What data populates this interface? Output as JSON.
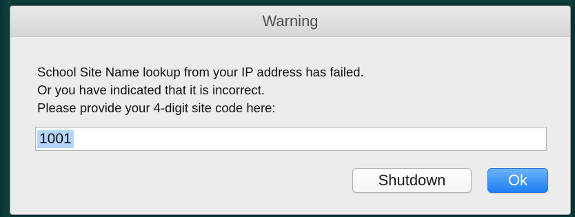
{
  "dialog": {
    "title": "Warning",
    "message_lines": [
      "School Site Name lookup from your IP address has failed.",
      "Or you have indicated that it is incorrect.",
      "Please provide your 4-digit site code here:"
    ],
    "site_code_input": {
      "value": "1001",
      "selected": true
    },
    "buttons": {
      "shutdown_label": "Shutdown",
      "ok_label": "Ok"
    }
  },
  "colors": {
    "desktop_background": "#0d3b3a",
    "dialog_background": "#ececec",
    "default_button": "#1e7ff2",
    "text_selection": "#b5d5ff"
  }
}
